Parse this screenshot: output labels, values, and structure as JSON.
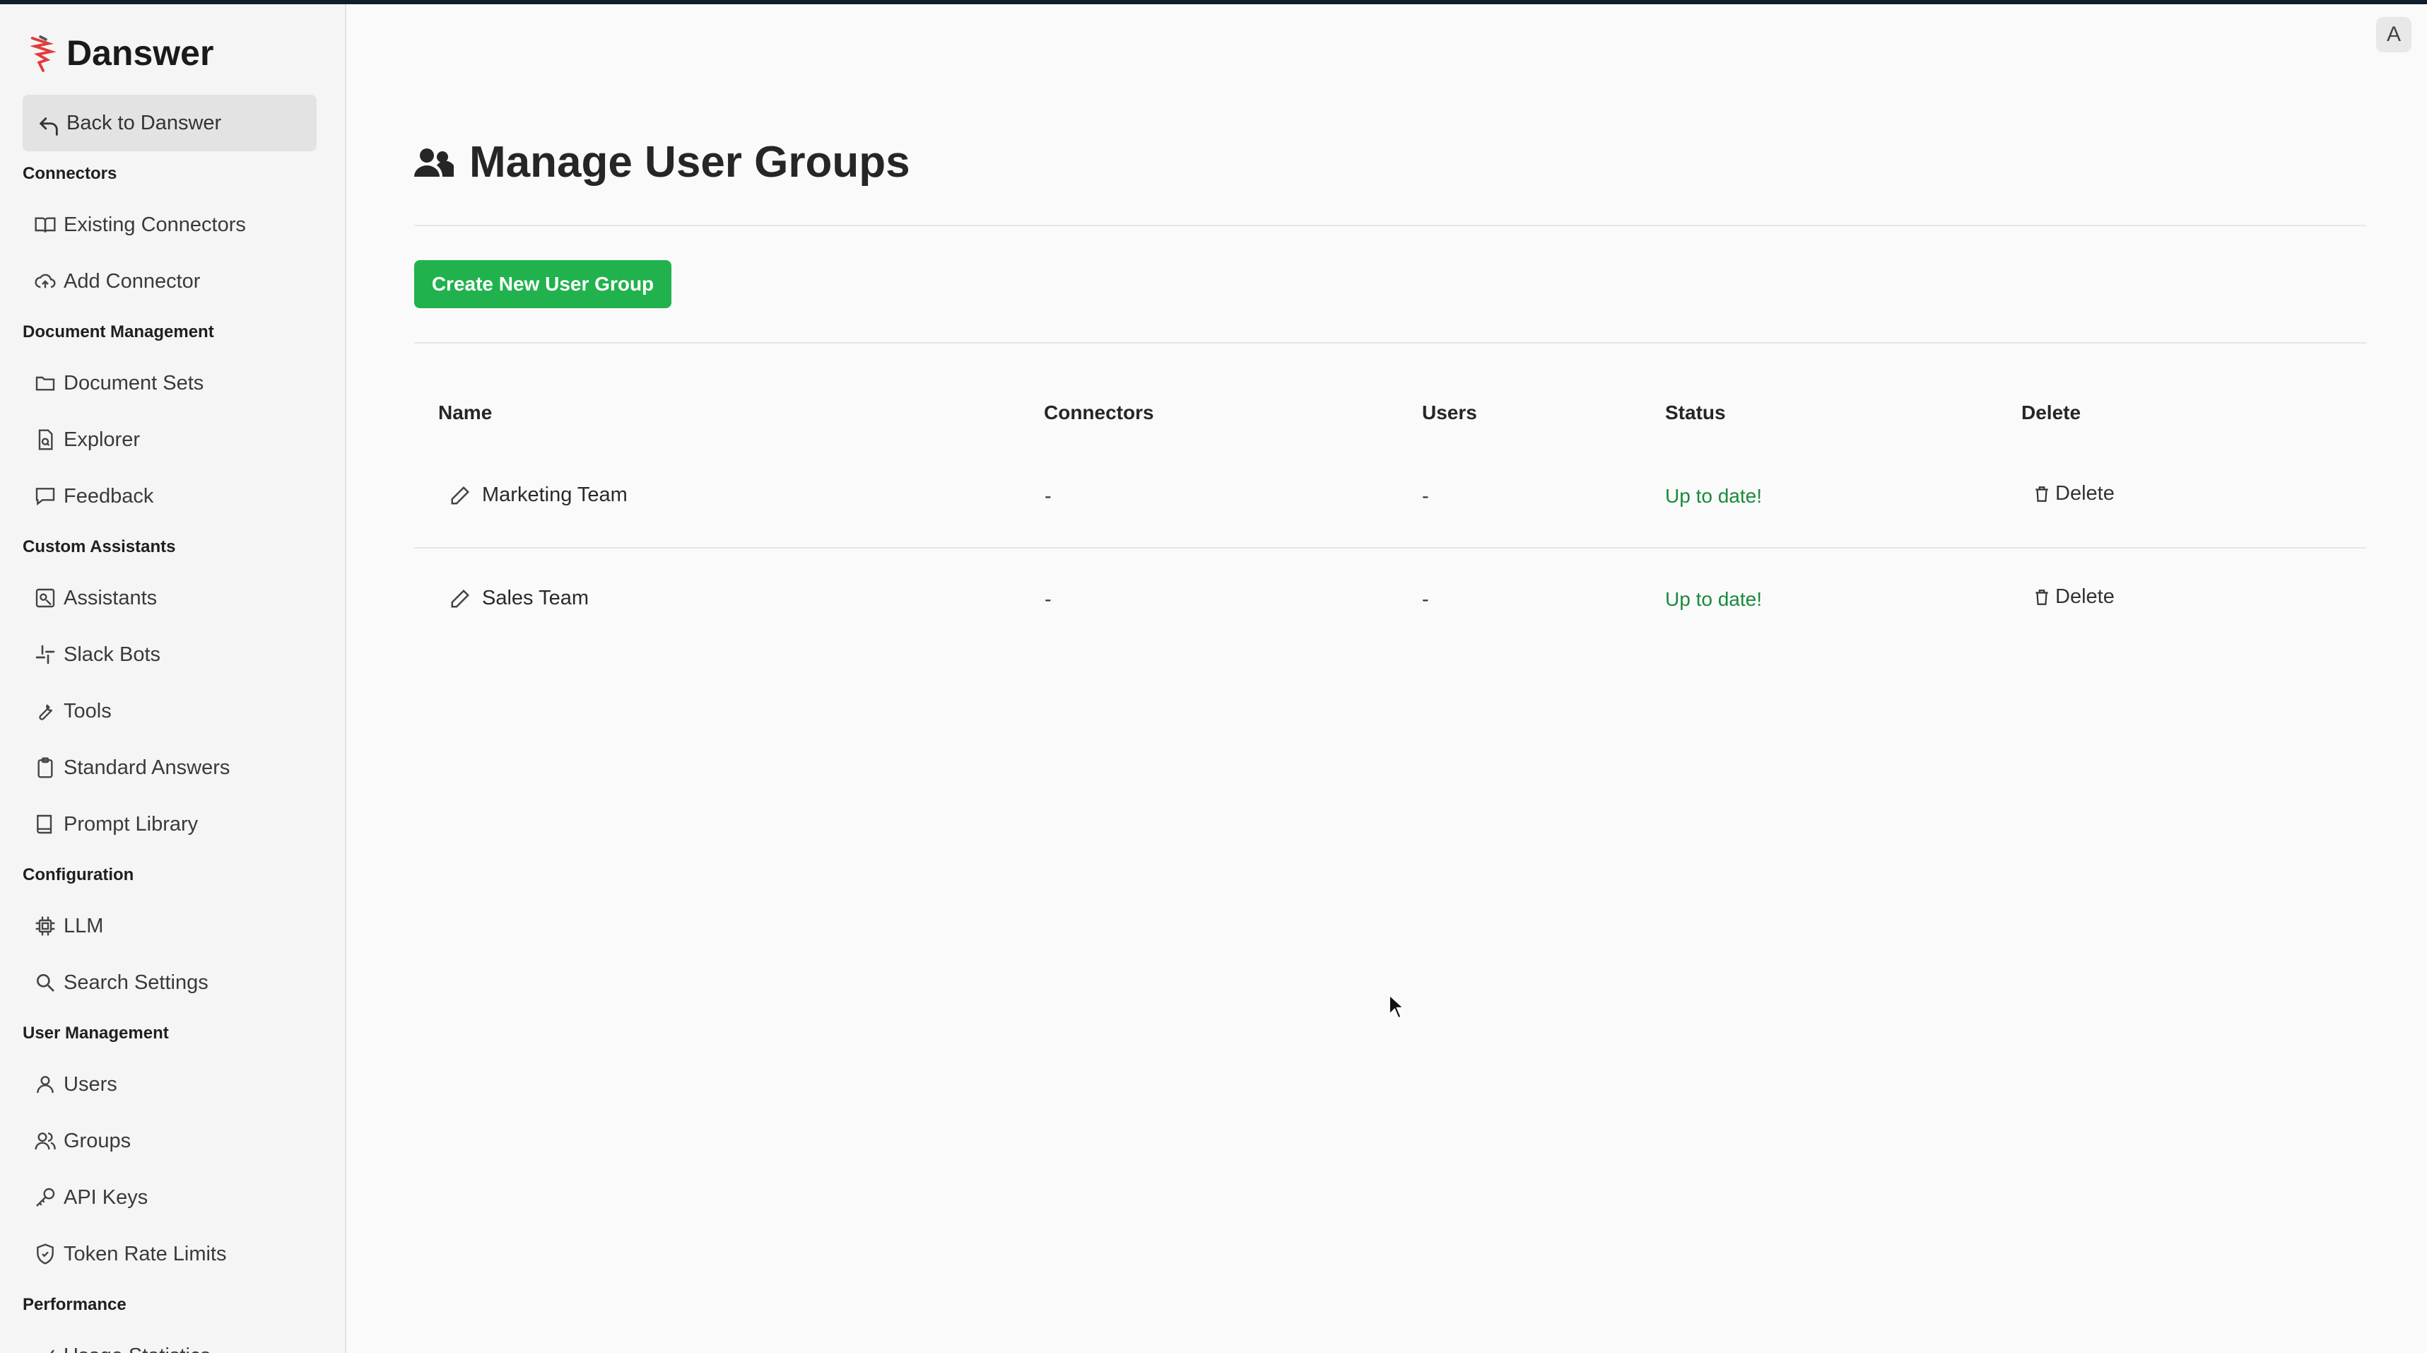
{
  "app": {
    "name": "Danswer",
    "avatar_initial": "A"
  },
  "sidebar": {
    "back_label": "Back to Danswer",
    "sections": [
      {
        "title": "Connectors",
        "items": [
          {
            "label": "Existing Connectors",
            "icon": "book-open-icon"
          },
          {
            "label": "Add Connector",
            "icon": "cloud-upload-icon"
          }
        ]
      },
      {
        "title": "Document Management",
        "items": [
          {
            "label": "Document Sets",
            "icon": "folder-icon"
          },
          {
            "label": "Explorer",
            "icon": "file-search-icon"
          },
          {
            "label": "Feedback",
            "icon": "message-icon"
          }
        ]
      },
      {
        "title": "Custom Assistants",
        "items": [
          {
            "label": "Assistants",
            "icon": "assistant-icon"
          },
          {
            "label": "Slack Bots",
            "icon": "slack-icon"
          },
          {
            "label": "Tools",
            "icon": "wrench-icon"
          },
          {
            "label": "Standard Answers",
            "icon": "clipboard-icon"
          },
          {
            "label": "Prompt Library",
            "icon": "book-icon"
          }
        ]
      },
      {
        "title": "Configuration",
        "items": [
          {
            "label": "LLM",
            "icon": "cpu-icon"
          },
          {
            "label": "Search Settings",
            "icon": "search-icon"
          }
        ]
      },
      {
        "title": "User Management",
        "items": [
          {
            "label": "Users",
            "icon": "user-icon"
          },
          {
            "label": "Groups",
            "icon": "users-icon"
          },
          {
            "label": "API Keys",
            "icon": "key-icon"
          },
          {
            "label": "Token Rate Limits",
            "icon": "shield-icon"
          }
        ]
      },
      {
        "title": "Performance",
        "items": [
          {
            "label": "Usage Statistics",
            "icon": "chart-icon"
          }
        ]
      }
    ]
  },
  "page": {
    "title": "Manage User Groups",
    "create_button": "Create New User Group",
    "columns": [
      "Name",
      "Connectors",
      "Users",
      "Status",
      "Delete"
    ],
    "rows": [
      {
        "name": "Marketing Team",
        "connectors": "-",
        "users": "-",
        "status": "Up to date!",
        "delete": "Delete"
      },
      {
        "name": "Sales Team",
        "connectors": "-",
        "users": "-",
        "status": "Up to date!",
        "delete": "Delete"
      }
    ]
  },
  "colors": {
    "accent_green": "#21b24d",
    "status_green": "#1a8a3c",
    "brand_red": "#e23b3b"
  }
}
